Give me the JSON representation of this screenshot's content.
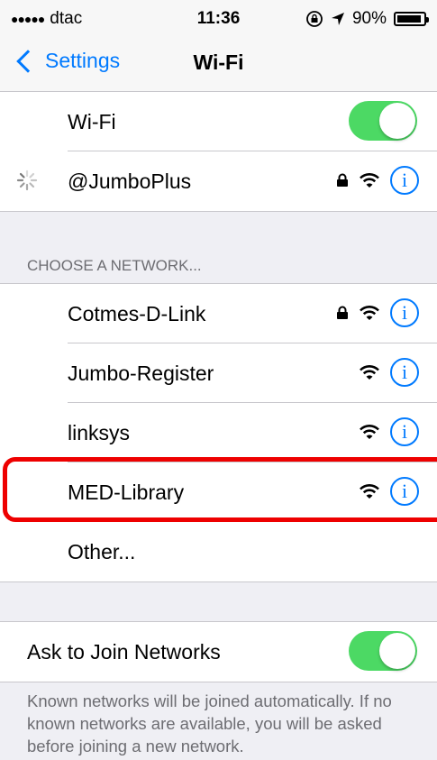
{
  "status_bar": {
    "signal": "●●●●●",
    "carrier": "dtac",
    "time": "11:36",
    "battery_percent": "90%",
    "battery_level": 0.9
  },
  "nav": {
    "back_label": "Settings",
    "title": "Wi-Fi"
  },
  "wifi": {
    "label": "Wi-Fi",
    "enabled": true,
    "current_network": {
      "name": "@JumboPlus",
      "secured": true,
      "connecting": true
    }
  },
  "choose_network": {
    "header": "CHOOSE A NETWORK...",
    "networks": [
      {
        "name": "Cotmes-D-Link",
        "secured": true
      },
      {
        "name": "Jumbo-Register",
        "secured": false
      },
      {
        "name": "linksys",
        "secured": false
      },
      {
        "name": "MED-Library",
        "secured": false,
        "highlighted": true
      }
    ],
    "other_label": "Other..."
  },
  "ask_to_join": {
    "label": "Ask to Join Networks",
    "enabled": true,
    "description": "Known networks will be joined automatically. If no known networks are available, you will be asked before joining a new network."
  },
  "icons": {
    "lock": "lock-icon",
    "wifi": "wifi-signal-icon",
    "info": "info-icon",
    "location": "location-arrow-icon",
    "rotation_lock": "rotation-lock-icon"
  },
  "colors": {
    "accent": "#007aff",
    "toggle_on": "#4cd964",
    "highlight": "#ee0000"
  }
}
